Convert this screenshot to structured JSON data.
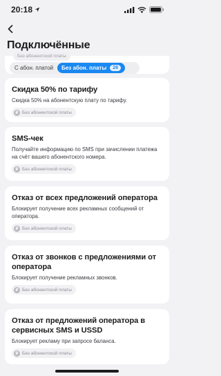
{
  "status_bar": {
    "time": "20:18"
  },
  "header": {
    "title": "Подключённые"
  },
  "ghost_tag": "Без абонентской платы",
  "tabs": {
    "with_fee": "С абон. платой",
    "without_fee": "Без абон. платы",
    "without_fee_count": "28"
  },
  "cards": [
    {
      "title": "Скидка 50% по тарифу",
      "desc": "Скидка 50% на абонентскую плату по тарифу.",
      "tag": "Без абонентской платы"
    },
    {
      "title": "SMS-чек",
      "desc": "Получайте информацию по SMS при зачислении платежа на счёт вашего абонентского номера.",
      "tag": "Без абонентской платы"
    },
    {
      "title": "Отказ от всех предложений оператора",
      "desc": "Блокирует получение всех рекламных сообщений от оператора.",
      "tag": "Без абонентской платы"
    },
    {
      "title": "Отказ от звонков с предложениями от оператора",
      "desc": "Блокирует получение рекламных звонков.",
      "tag": "Без абонентской платы"
    },
    {
      "title": "Отказ от предложений оператора в сервисных SMS и USSD",
      "desc": "Блокирует рекламу при запросе баланса.",
      "tag": "Без абонентской платы"
    }
  ]
}
